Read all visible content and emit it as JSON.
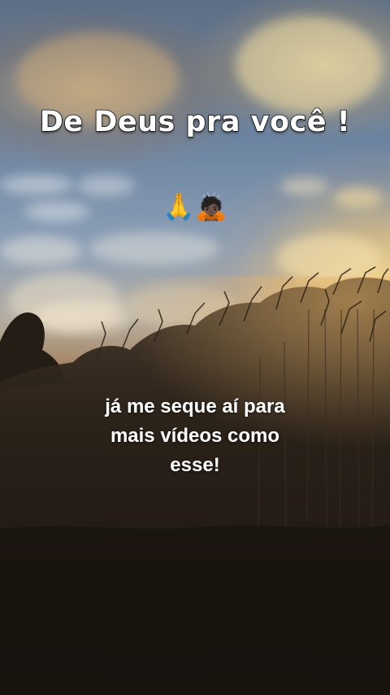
{
  "video": {
    "title": "De Deus pra você !",
    "emojis": [
      "🙏",
      "🙇🏿"
    ],
    "caption_lines": [
      "já me seque aí para",
      "mais vídeos como",
      "esse!"
    ]
  },
  "colors": {
    "title_text": "#ffffff",
    "title_outline": "#121212",
    "caption_text": "#ffffff",
    "sun_glow": "#ffde8c"
  }
}
